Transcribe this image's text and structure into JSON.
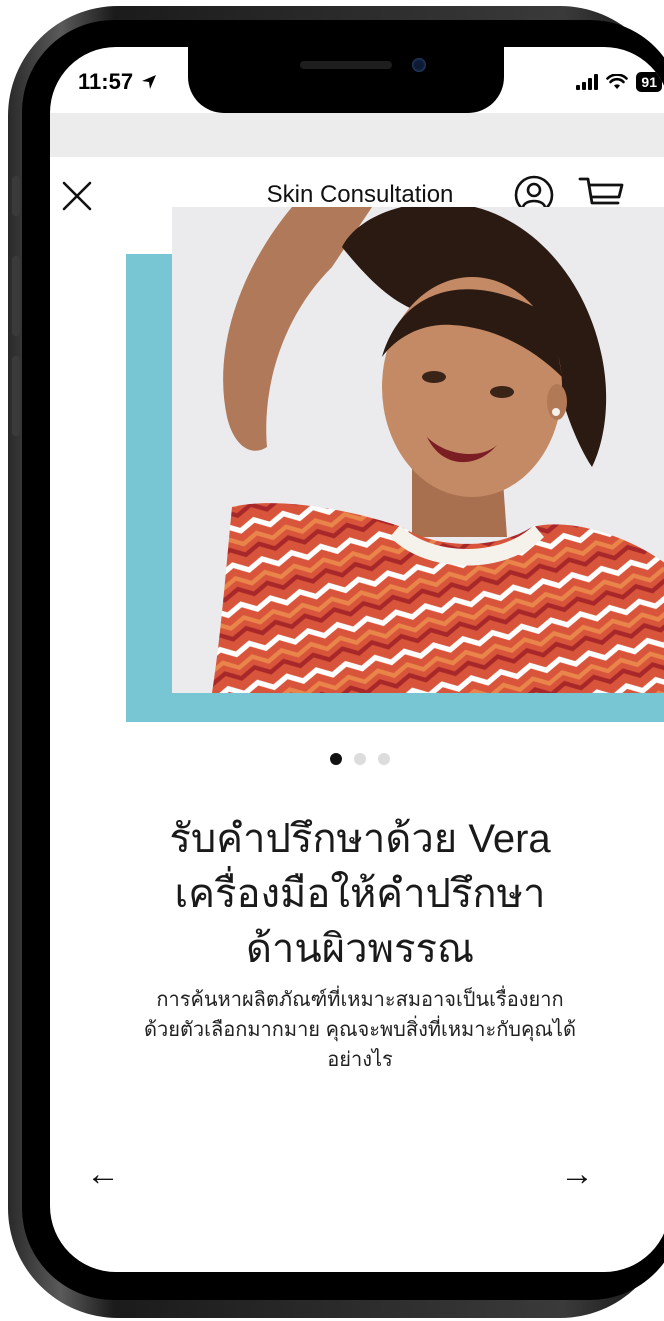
{
  "status": {
    "time": "11:57",
    "battery": "91"
  },
  "header": {
    "title": "Skin Consultation"
  },
  "carousel": {
    "slide_count": 3,
    "active_index": 0
  },
  "content": {
    "heading": "รับคำปรึกษาด้วย Vera\nเครื่องมือให้คำปรึกษา\nด้านผิวพรรณ",
    "description": "การค้นหาผลิตภัณฑ์ที่เหมาะสมอาจเป็นเรื่องยาก\nด้วยตัวเลือกมากมาย คุณจะพบสิ่งที่เหมาะกับคุณได้\nอย่างไร"
  },
  "nav": {
    "prev_symbol": "←",
    "next_symbol": "→"
  },
  "colors": {
    "accent_teal": "#78c5d3",
    "frame": "#1b1b1b"
  },
  "icons": {
    "close": "close-icon",
    "account": "user-icon",
    "cart": "cart-icon",
    "location": "location-arrow-icon"
  }
}
